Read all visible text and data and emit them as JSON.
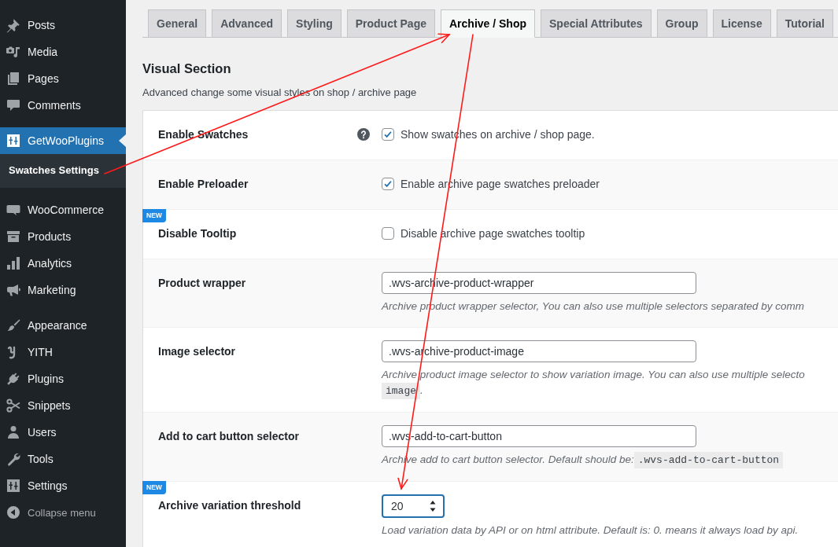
{
  "sidebar": {
    "groups": [
      {
        "items": [
          {
            "label": "Posts",
            "selected": false
          },
          {
            "label": "Media",
            "selected": false
          },
          {
            "label": "Pages",
            "selected": false
          },
          {
            "label": "Comments",
            "selected": false
          }
        ]
      },
      {
        "items": [
          {
            "label": "GetWooPlugins",
            "selected": true,
            "children": [
              {
                "label": "Swatches Settings",
                "selected": true
              }
            ]
          }
        ]
      },
      {
        "items": [
          {
            "label": "WooCommerce",
            "selected": false
          },
          {
            "label": "Products",
            "selected": false
          },
          {
            "label": "Analytics",
            "selected": false
          },
          {
            "label": "Marketing",
            "selected": false
          }
        ]
      },
      {
        "items": [
          {
            "label": "Appearance",
            "selected": false
          },
          {
            "label": "YITH",
            "selected": false
          },
          {
            "label": "Plugins",
            "selected": false
          },
          {
            "label": "Snippets",
            "selected": false
          },
          {
            "label": "Users",
            "selected": false
          },
          {
            "label": "Tools",
            "selected": false
          },
          {
            "label": "Settings",
            "selected": false
          }
        ]
      }
    ],
    "collapse_label": "Collapse menu"
  },
  "tabs": [
    {
      "label": "General",
      "selected": false
    },
    {
      "label": "Advanced",
      "selected": false
    },
    {
      "label": "Styling",
      "selected": false
    },
    {
      "label": "Product Page",
      "selected": false
    },
    {
      "label": "Archive / Shop",
      "selected": true
    },
    {
      "label": "Special Attributes",
      "selected": false
    },
    {
      "label": "Group",
      "selected": false
    },
    {
      "label": "License",
      "selected": false
    },
    {
      "label": "Tutorial",
      "selected": false
    }
  ],
  "section": {
    "title": "Visual Section",
    "description": "Advanced change some visual styles on shop / archive page"
  },
  "rows": [
    {
      "label": "Enable Swatches",
      "kind": "checkbox",
      "help": true,
      "checked": true,
      "text": "Show swatches on archive / shop page."
    },
    {
      "label": "Enable Preloader",
      "kind": "checkbox",
      "help": false,
      "checked": true,
      "text": "Enable archive page swatches preloader"
    },
    {
      "label": "Disable Tooltip",
      "kind": "checkbox",
      "badge": "NEW",
      "help": false,
      "checked": false,
      "text": "Disable archive page swatches tooltip"
    },
    {
      "label": "Product wrapper",
      "kind": "text",
      "help": false,
      "value": ".wvs-archive-product-wrapper",
      "description": [
        [
          {
            "kind": "text",
            "text": "Archive product wrapper selector, You can also use multiple selectors separated by comm"
          }
        ]
      ]
    },
    {
      "label": "Image selector",
      "kind": "text",
      "help": false,
      "value": ".wvs-archive-product-image",
      "description": [
        [
          {
            "kind": "text",
            "text": "Archive product image selector to show variation image. You can also use multiple selecto"
          }
        ],
        [
          {
            "kind": "code",
            "text": "image"
          },
          {
            "kind": "text",
            "text": "."
          }
        ]
      ]
    },
    {
      "label": "Add to cart button selector",
      "kind": "text",
      "help": false,
      "value": ".wvs-add-to-cart-button",
      "description": [
        [
          {
            "kind": "text",
            "text": "Archive add to cart button selector. Default should be:"
          },
          {
            "kind": "code",
            "text": ".wvs-add-to-cart-button"
          }
        ]
      ]
    },
    {
      "label": "Archive variation threshold",
      "kind": "number",
      "badge": "NEW",
      "help": false,
      "focused": true,
      "value": "20",
      "description": [
        [
          {
            "kind": "text",
            "text": "Load variation data by API or on html attribute. Default is: 0. means it always load by api."
          }
        ]
      ]
    }
  ]
}
